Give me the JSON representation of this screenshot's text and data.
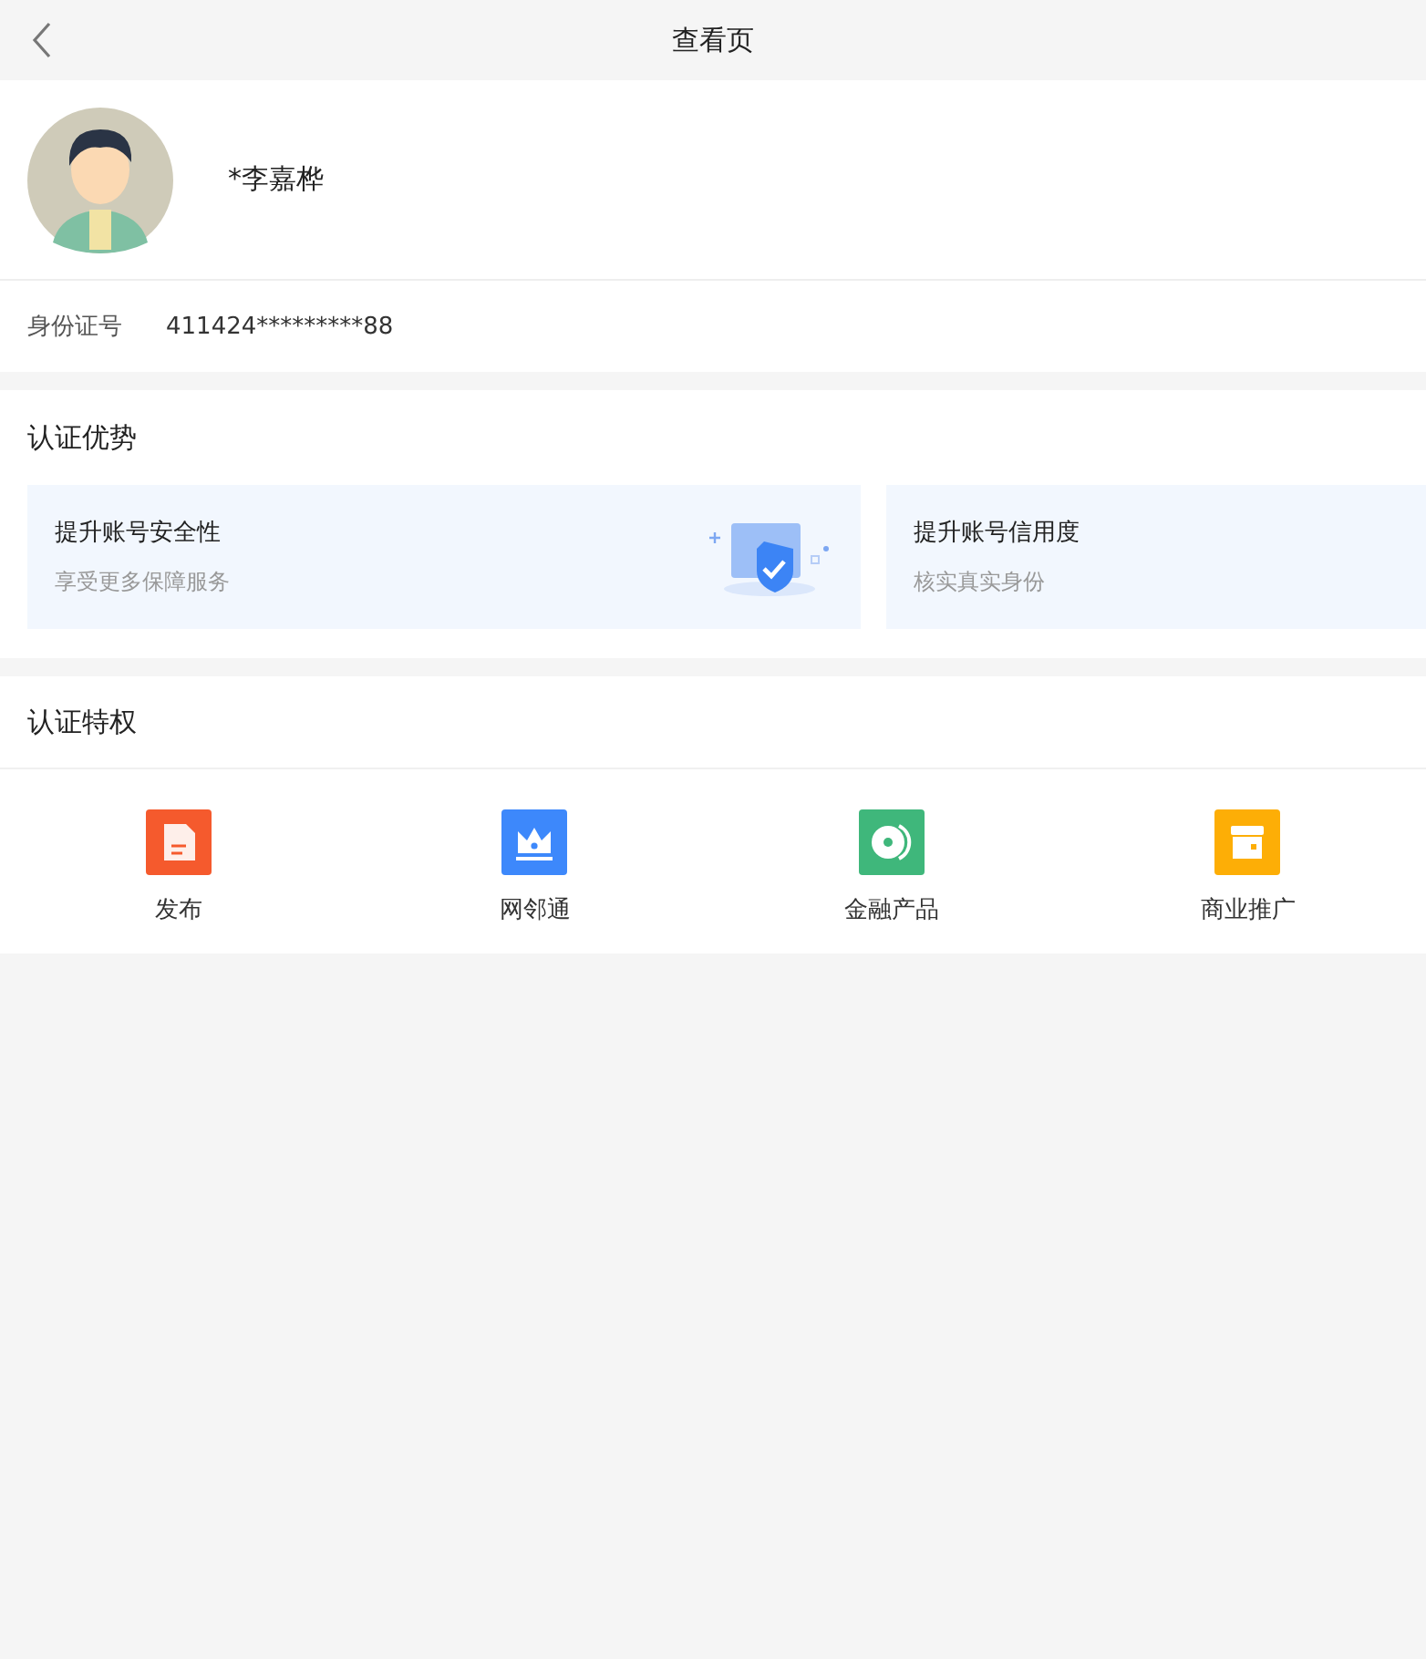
{
  "nav_bar": {
    "title": "查看页"
  },
  "profile": {
    "name": "*李嘉桦",
    "id_label": "身份证号",
    "id_value": "411424*********88"
  },
  "advantages": {
    "title": "认证优势",
    "cards": [
      {
        "title": "提升账号安全性",
        "subtitle": "享受更多保障服务",
        "kind": "shield"
      },
      {
        "title": "提升账号信用度",
        "subtitle": "核实真实身份",
        "kind": "none"
      }
    ]
  },
  "privileges": {
    "title": "认证特权",
    "items": [
      {
        "label": "发布",
        "kind": "document",
        "color": "#f55a2d"
      },
      {
        "label": "网邻通",
        "kind": "crown",
        "color": "#3d88fb"
      },
      {
        "label": "金融产品",
        "kind": "coin",
        "color": "#3fb77b"
      },
      {
        "label": "商业推广",
        "kind": "shop",
        "color": "#fdae06"
      }
    ]
  }
}
